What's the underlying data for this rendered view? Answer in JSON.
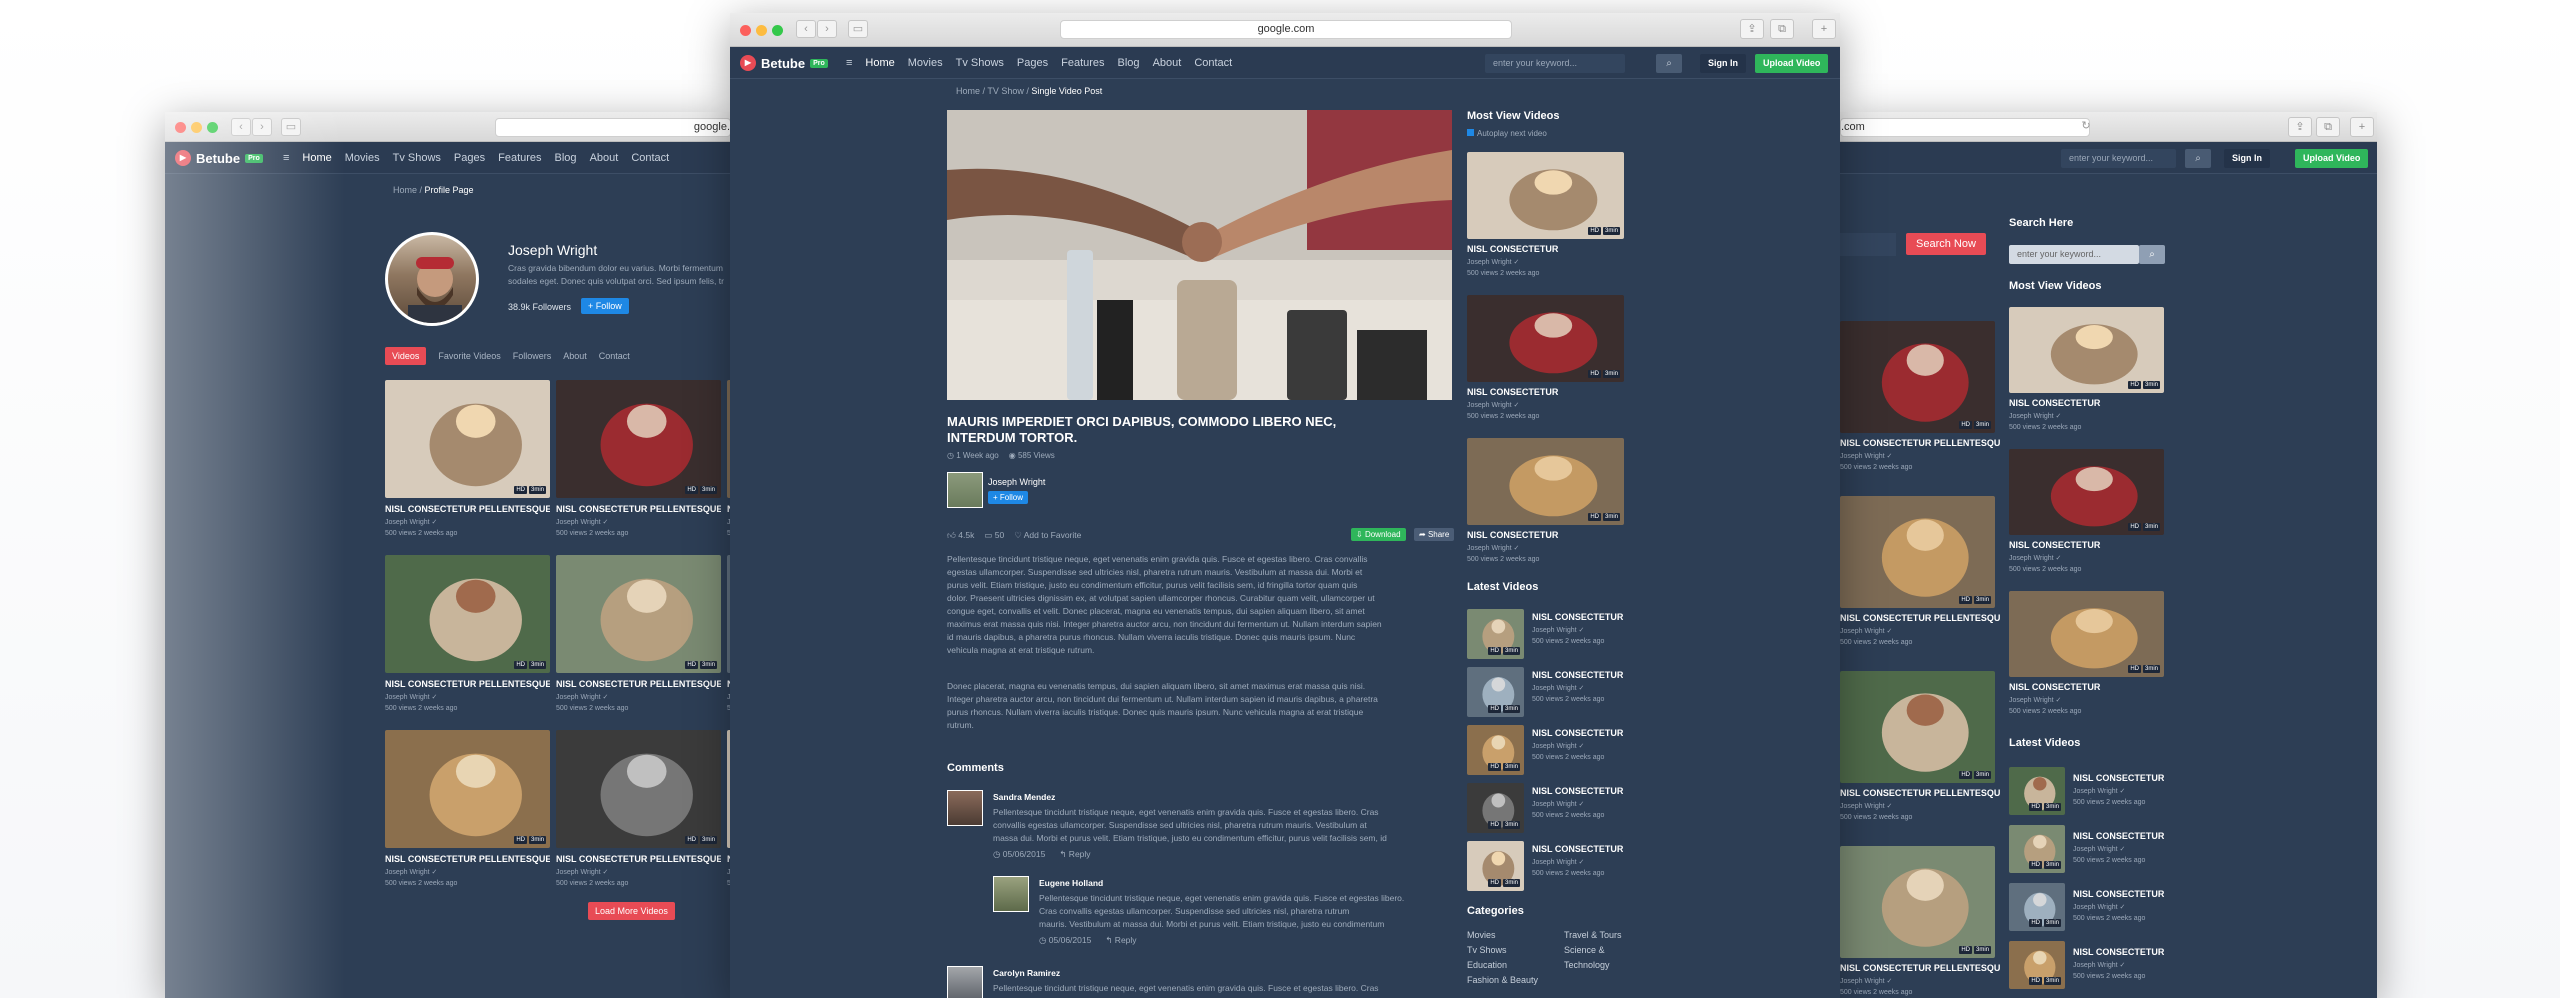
{
  "browser": {
    "url": "google.com",
    "url_left": "google.",
    "url_right": ".com"
  },
  "nav": {
    "logo": "Betube",
    "pro": "Pro",
    "menu": [
      "Home",
      "Movies",
      "Tv Shows",
      "Pages",
      "Features",
      "Blog",
      "About",
      "Contact"
    ],
    "search_placeholder": "enter your keyword...",
    "sign_in": "Sign In",
    "upload": "Upload Video"
  },
  "left": {
    "breadcrumb": {
      "home": "Home",
      "sep": "/",
      "current": "Profile Page"
    },
    "profile": {
      "name": "Joseph Wright",
      "bio_1": "Cras gravida bibendum dolor eu varius. Morbi fermentum",
      "bio_2": "sodales eget. Donec quis volutpat orci. Sed ipsum felis, tr",
      "followers": "38.9k Followers",
      "follow": "+ Follow"
    },
    "tabs": [
      "Videos",
      "Favorite Videos",
      "Followers",
      "About",
      "Contact"
    ],
    "video_title": "NISL CONSECTETUR PELLENTESQUE",
    "author": "Joseph Wright",
    "views": "500 views",
    "ago": "2 weeks ago",
    "hd": "HD",
    "dur": "3min",
    "load_more": "Load More Videos"
  },
  "main": {
    "breadcrumb": {
      "home": "Home",
      "tv": "TV Show",
      "current": "Single Video Post"
    },
    "title_1": "MAURIS IMPERDIET ORCI DAPIBUS, COMMODO LIBERO NEC,",
    "title_2": "INTERDUM TORTOR.",
    "posted": "1 Week ago",
    "views": "585 Views",
    "author": "Joseph Wright",
    "follow": "+ Follow",
    "likes": "4.5k",
    "comments_count": "50",
    "add_fav": "Add to Favorite",
    "download": "Download",
    "share": "Share",
    "desc_1": [
      "Pellentesque tincidunt tristique neque, eget venenatis enim gravida quis. Fusce et egestas libero. Cras convallis",
      "egestas ullamcorper. Suspendisse sed ultricies nisl, pharetra rutrum mauris. Vestibulum at massa dui. Morbi et",
      "purus velit. Etiam tristique, justo eu condimentum efficitur, purus velit facilisis sem, id fringilla tortor quam quis",
      "dolor. Praesent ultricies dignissim ex, at volutpat sapien ullamcorper rhoncus. Curabitur quam velit, ullamcorper ut",
      "congue eget, convallis et velit. Donec placerat, magna eu venenatis tempus, dui sapien aliquam libero, sit amet",
      "maximus erat massa quis nisi. Integer pharetra auctor arcu, non tincidunt dui fermentum ut. Nullam interdum sapien",
      "id mauris dapibus, a pharetra purus rhoncus. Nullam viverra iaculis tristique. Donec quis mauris ipsum. Nunc",
      "vehicula magna at erat tristique rutrum."
    ],
    "desc_2": [
      "Donec placerat, magna eu venenatis tempus, dui sapien aliquam libero, sit amet maximus erat massa quis nisi.",
      "Integer pharetra auctor arcu, non tincidunt dui fermentum ut. Nullam interdum sapien id mauris dapibus, a pharetra",
      "purus rhoncus. Nullam viverra iaculis tristique. Donec quis mauris ipsum. Nunc vehicula magna at erat tristique",
      "rutrum."
    ],
    "comments_heading": "Comments",
    "comments": [
      {
        "name": "Sandra Mendez",
        "lines": [
          "Pellentesque tincidunt tristique neque, eget venenatis enim gravida quis. Fusce et egestas libero. Cras",
          "convallis egestas ullamcorper. Suspendisse sed ultricies nisl, pharetra rutrum mauris. Vestibulum at",
          "massa dui. Morbi et purus velit. Etiam tristique, justo eu condimentum efficitur, purus velit facilisis sem, id"
        ],
        "date": "05/06/2015",
        "reply": "Reply"
      },
      {
        "name": "Eugene Holland",
        "lines": [
          "Pellentesque tincidunt tristique neque, eget venenatis enim gravida quis. Fusce et egestas libero.",
          "Cras convallis egestas ullamcorper. Suspendisse sed ultricies nisl, pharetra rutrum",
          "mauris. Vestibulum at massa dui. Morbi et purus velit. Etiam tristique, justo eu condimentum"
        ],
        "date": "05/06/2015",
        "reply": "Reply"
      },
      {
        "name": "Carolyn Ramirez",
        "lines": [
          "Pellentesque tincidunt tristique neque, eget venenatis enim gravida quis. Fusce et egestas libero. Cras"
        ]
      }
    ]
  },
  "sidebar": {
    "most_view": "Most View Videos",
    "autoplay": "Autoplay next video",
    "item_title": "NISL CONSECTETUR",
    "author": "Joseph Wright",
    "views": "500 views",
    "ago": "2 weeks ago",
    "latest": "Latest Videos",
    "categories": "Categories",
    "cats_left": [
      "Movies",
      "Tv Shows",
      "Education",
      "Fashion & Beauty"
    ],
    "cats_right": [
      "Travel & Tours",
      "Science &",
      "Technology"
    ]
  },
  "right": {
    "search_here": "Search Here",
    "search_now": "Search Now",
    "search_placeholder": "enter your keyword...",
    "most_view": "Most View Videos",
    "latest": "Latest Videos",
    "wide_title": "NISL CONSECTETUR PELLENTESQUE",
    "item_title": "NISL CONSECTETUR"
  },
  "colors": {
    "bg": "#2d3e55",
    "accent_red": "#e84b55",
    "accent_green": "#2fb65b",
    "accent_blue": "#1e88e5"
  }
}
